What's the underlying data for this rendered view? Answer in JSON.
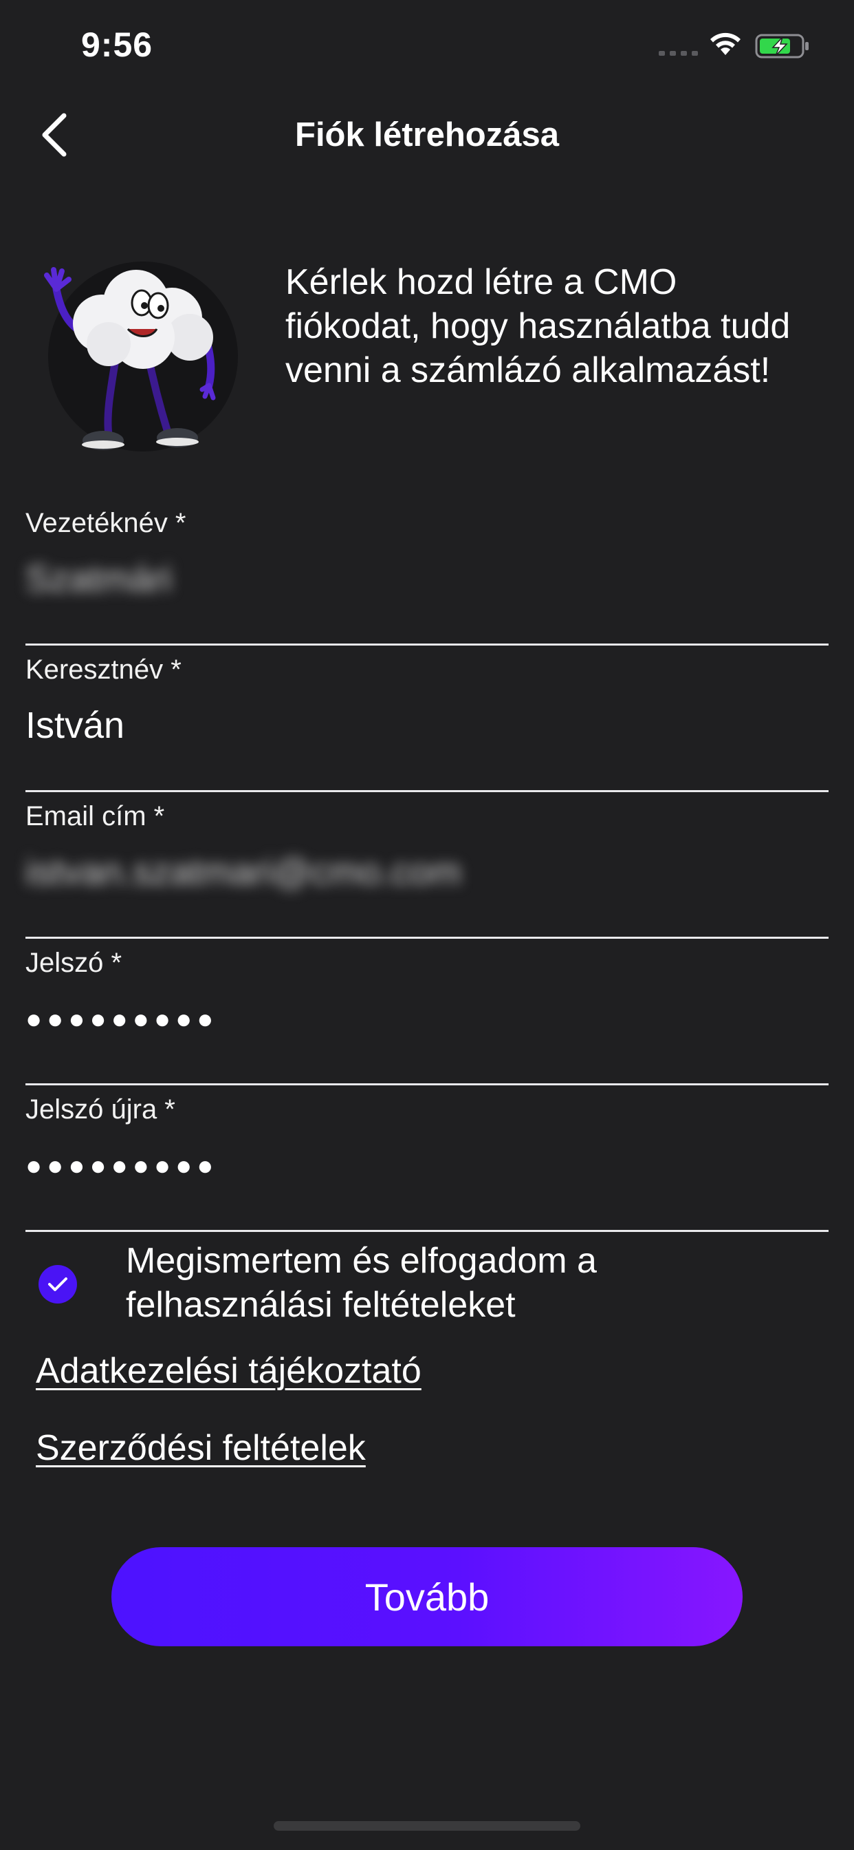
{
  "status_bar": {
    "time": "9:56",
    "icons": [
      "signal-dots-icon",
      "wifi-icon",
      "battery-charging-icon"
    ],
    "battery_color": "#32d74b"
  },
  "nav": {
    "back_icon": "chevron-left-icon",
    "title": "Fiók létrehozása"
  },
  "intro": {
    "mascot_icon": "cloud-mascot-icon",
    "text": "Kérlek hozd létre a CMO fiókodat, hogy használatba tudd venni a számlázó alkalmazást!"
  },
  "form": {
    "last_name": {
      "label": "Vezetéknév *",
      "value": "Szatmári"
    },
    "first_name": {
      "label": "Keresztnév *",
      "value": "István"
    },
    "email": {
      "label": "Email cím *",
      "value": "istvan.szatmari@cmo.com"
    },
    "password": {
      "label": "Jelszó *",
      "value": "●●●●●●●●●"
    },
    "password_confirm": {
      "label": "Jelszó újra *",
      "value": "●●●●●●●●●"
    }
  },
  "terms": {
    "checked": true,
    "text": "Megismertem és elfogadom a felhasználási feltételeket"
  },
  "links": {
    "privacy": "Adatkezelési tájékoztató",
    "contract": "Szerződési feltételek"
  },
  "actions": {
    "next_label": "Tovább"
  },
  "colors": {
    "background": "#1f1f21",
    "accent": "#4a14f5",
    "accent_end": "#8716ff"
  }
}
